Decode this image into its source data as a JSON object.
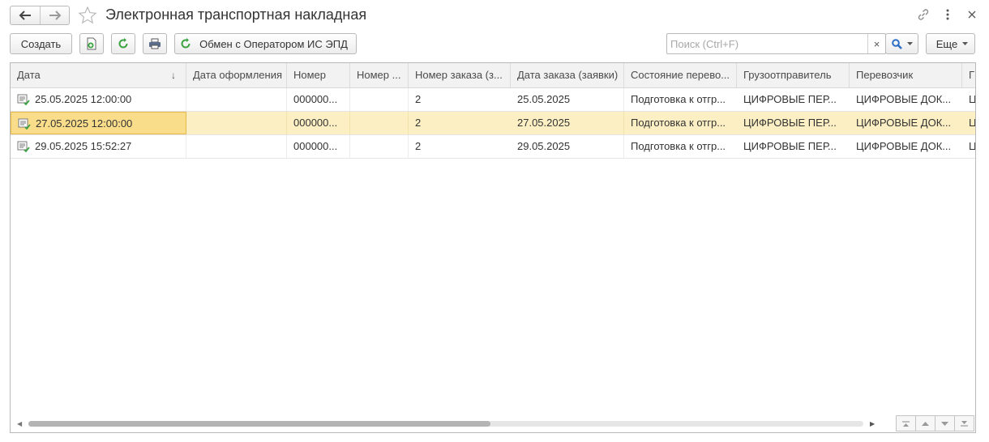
{
  "window": {
    "title": "Электронная транспортная накладная"
  },
  "toolbar": {
    "create_label": "Создать",
    "exchange_label": "Обмен с Оператором ИС ЭПД",
    "more_label": "Еще"
  },
  "search": {
    "placeholder": "Поиск (Ctrl+F)",
    "value": "",
    "clear_glyph": "×"
  },
  "table": {
    "columns": [
      "Дата",
      "Дата оформления",
      "Номер",
      "Номер ...",
      "Номер заказа (з...",
      "Дата заказа (заявки)",
      "Состояние перево...",
      "Грузоотправитель",
      "Перевозчик",
      "Г"
    ],
    "sort_indicator": "↓",
    "rows": [
      [
        "25.05.2025 12:00:00",
        "",
        "000000...",
        "",
        "2",
        "25.05.2025",
        "Подготовка к отгр...",
        "ЦИФРОВЫЕ ПЕР...",
        "ЦИФРОВЫЕ ДОК...",
        "Ц"
      ],
      [
        "27.05.2025 12:00:00",
        "",
        "000000...",
        "",
        "2",
        "27.05.2025",
        "Подготовка к отгр...",
        "ЦИФРОВЫЕ ПЕР...",
        "ЦИФРОВЫЕ ДОК...",
        "Ц"
      ],
      [
        "29.05.2025 15:52:27",
        "",
        "000000...",
        "",
        "2",
        "29.05.2025",
        "Подготовка к отгр...",
        "ЦИФРОВЫЕ ПЕР...",
        "ЦИФРОВЫЕ ДОК...",
        "Ц"
      ]
    ],
    "selected_row": 1
  },
  "colors": {
    "selection": "#fbefc3",
    "accent_green": "#3aa340",
    "search_blue": "#2b6cc4"
  }
}
